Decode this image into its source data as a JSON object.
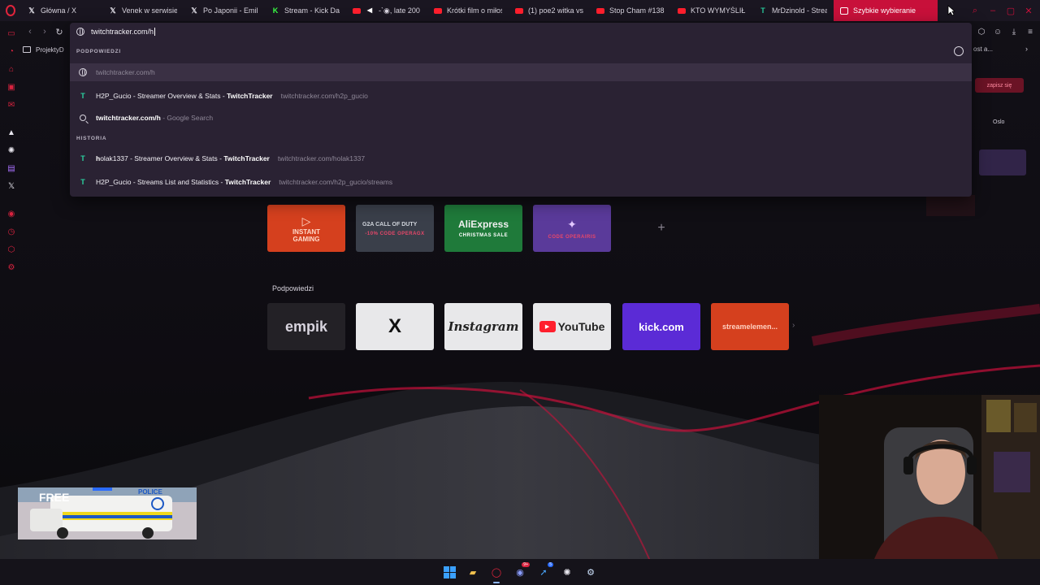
{
  "tabs": [
    {
      "icon": "x-icon",
      "label": "Główna / X"
    },
    {
      "icon": "x-icon",
      "label": "Venek w serwisie"
    },
    {
      "icon": "x-icon",
      "label": "Po Japonii - Emil"
    },
    {
      "icon": "kick-icon",
      "label": "Stream - Kick Da"
    },
    {
      "icon": "youtube-icon",
      "label": "-`◉, late 200"
    },
    {
      "icon": "youtube-icon",
      "label": "Krótki film o miłoś"
    },
    {
      "icon": "youtube-icon",
      "label": "(1) poe2 witka vs"
    },
    {
      "icon": "youtube-icon",
      "label": "Stop Cham #138"
    },
    {
      "icon": "youtube-icon",
      "label": "KTO WYMYŚLIŁ T"
    },
    {
      "icon": "twitchtracker-icon",
      "label": "MrDzinold - Strea"
    },
    {
      "icon": "grid-icon",
      "label": "Szybkie wybieranie",
      "active": true
    }
  ],
  "address": {
    "value": "twitchtracker.com/h"
  },
  "bookmarks": {
    "first": "ProjektyD",
    "overflow": "ost a..."
  },
  "omnibox": {
    "suggestions_header": "PODPOWIEDZI",
    "history_header": "HISTORIA",
    "first_row": "twitchtracker.com/h",
    "rows": [
      {
        "title_plain": "H2P_Gucio - Streamer Overview & Stats - ",
        "title_bold": "TwitchTracker",
        "url": "twitchtracker.com/h2p_gucio"
      },
      {
        "title_bold_prefix": "twitchtracker.com/h",
        "suffix": " - Google Search"
      },
      {
        "title_bold_first": "h",
        "title_plain": "olak1337 - Streamer Overview & Stats - ",
        "title_bold": "TwitchTracker",
        "url": "twitchtracker.com/holak1337"
      },
      {
        "title_plain": "H2P_Gucio - Streams List and Statistics - ",
        "title_bold": "TwitchTracker",
        "url": "twitchtracker.com/h2p_gucio/streams"
      }
    ]
  },
  "speed_dial": {
    "top_row": [
      {
        "name": "INSTANT GAMING",
        "sub": "",
        "bg": "#d5401e"
      },
      {
        "name": "G2A CALL OF DUTY",
        "sub": "-10% CODE OPERAGX",
        "bg": "#3a3f4a"
      },
      {
        "name": "AliExpress",
        "sub": "CHRISTMAS SALE",
        "bg": "#1f7a3a"
      },
      {
        "name": "",
        "sub": "CODE OPERAIRIS",
        "bg": "#5a3a9a"
      }
    ],
    "section_label": "Podpowiedzi",
    "suggestions": [
      {
        "name": "empik",
        "bg": "#232126",
        "color": "#d8d4de"
      },
      {
        "name": "X",
        "bg": "#e8e8ea",
        "color": "#111"
      },
      {
        "name": "Instagram",
        "bg": "#e8e8ea",
        "color": "#222"
      },
      {
        "name": "YouTube",
        "bg": "#e8e8ea",
        "color": "#222"
      },
      {
        "name": "kick.com",
        "bg": "#5b2bd6",
        "color": "#fff"
      },
      {
        "name": "streamelemen...",
        "bg": "#d5401e",
        "color": "#ffd0c0"
      }
    ]
  },
  "right_panel": {
    "button": "zapisz się",
    "text": "Oslo"
  },
  "van_text": {
    "line1": "FREE",
    "police": "POLICE"
  },
  "taskbar": {
    "messenger_badge": "9+",
    "app_badge": "5"
  },
  "colors": {
    "accent": "#c8103a",
    "omnibox_bg": "#2a2233",
    "twitchtracker": "#2bd3a0"
  }
}
